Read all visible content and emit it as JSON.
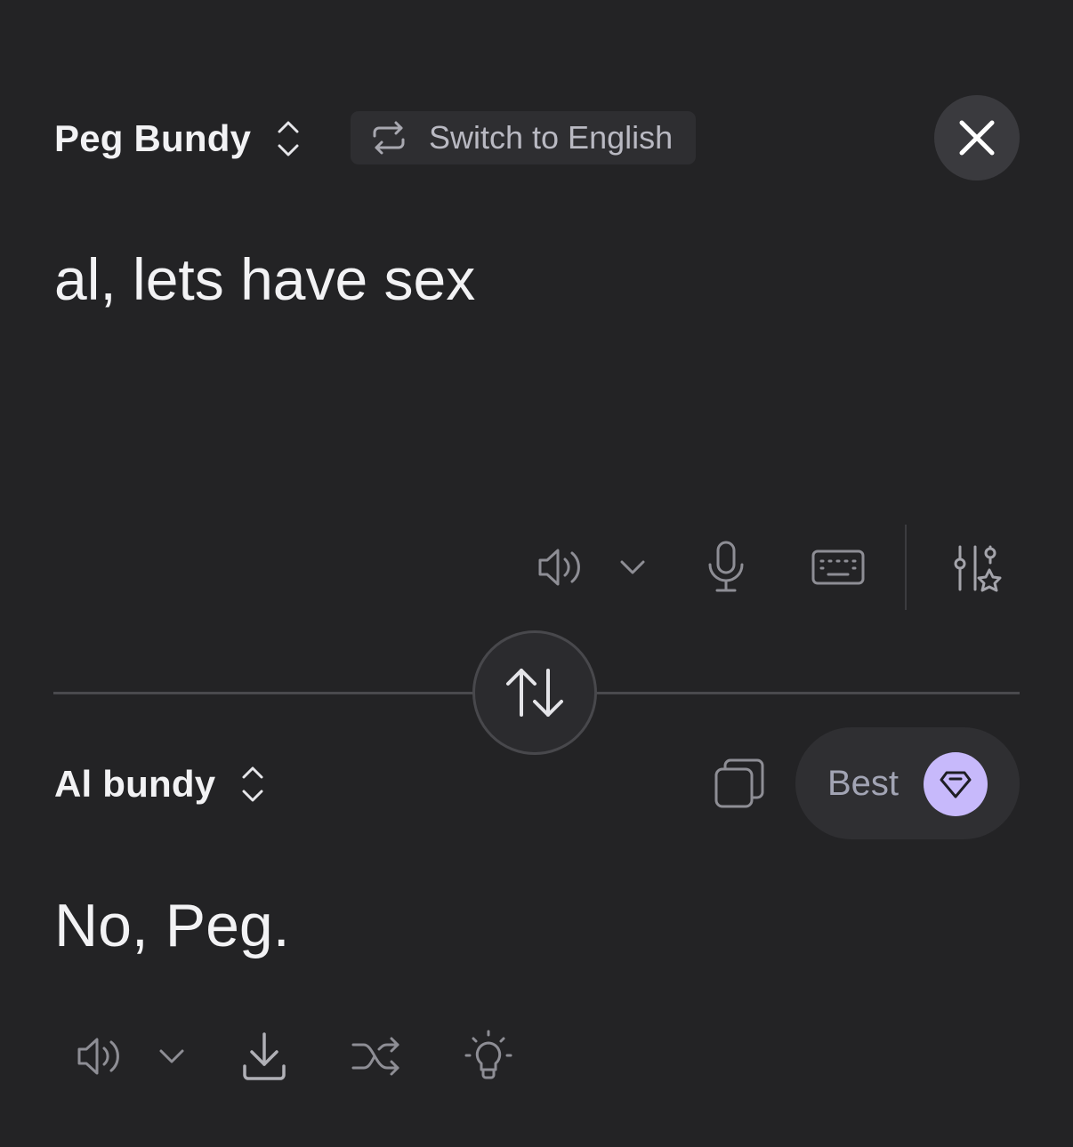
{
  "source": {
    "language": "Peg Bundy",
    "switch_label": "Switch to English",
    "text": "al, lets have sex",
    "icons": {
      "language_picker": "chevron-up-down-icon",
      "switch": "repeat-arrows-icon",
      "close": "close-icon",
      "speaker": "speaker-icon",
      "speaker_menu": "chevron-down-icon",
      "microphone": "microphone-icon",
      "keyboard": "keyboard-icon",
      "settings": "sliders-star-icon"
    }
  },
  "swap": {
    "icon": "swap-vertical-arrows-icon"
  },
  "target": {
    "language": "Al bundy",
    "best_label": "Best",
    "text": "No, Peg.",
    "icons": {
      "language_picker": "chevron-up-down-icon",
      "copy": "copy-icon",
      "gem": "gem-icon",
      "speaker": "speaker-icon",
      "speaker_menu": "chevron-down-icon",
      "download": "download-icon",
      "shuffle": "shuffle-icon",
      "idea": "lightbulb-icon"
    }
  },
  "colors": {
    "background": "#232325",
    "text_primary": "#f2f2f4",
    "icon_muted": "#8e8e95",
    "accent_gem": "#c7b9fb"
  }
}
